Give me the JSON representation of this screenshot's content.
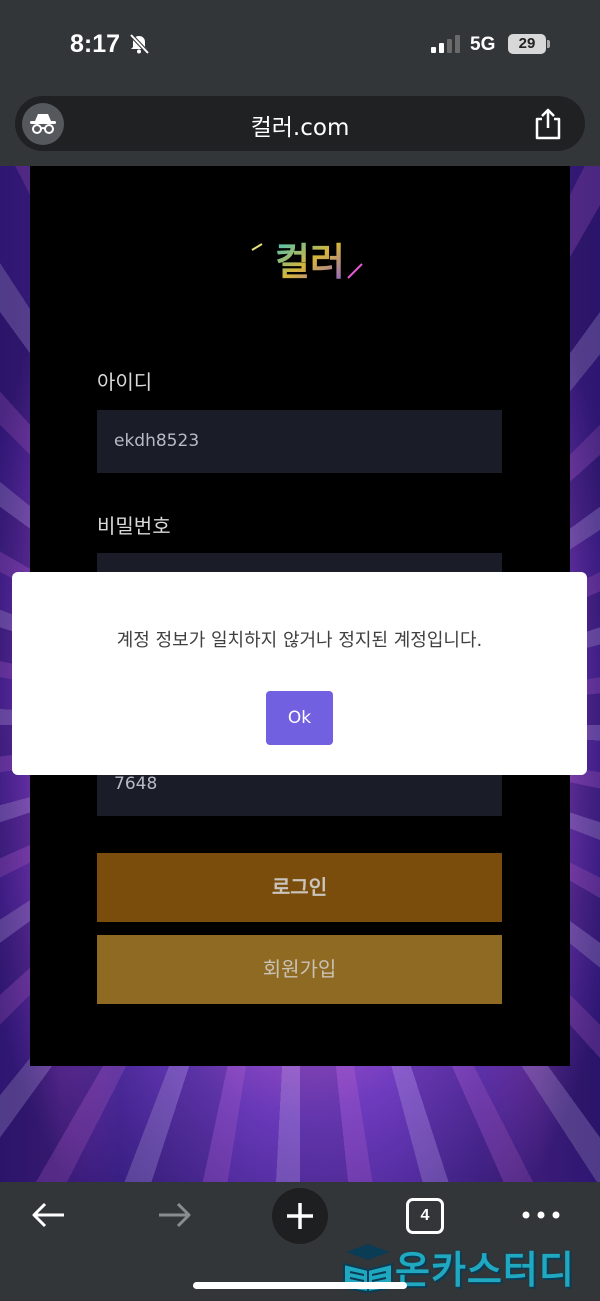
{
  "status_bar": {
    "time": "8:17",
    "network": "5G",
    "battery": "29"
  },
  "address_bar": {
    "url": "컬러.com"
  },
  "page": {
    "logo_text": "컬러",
    "id_label": "아이디",
    "id_value": "ekdh8523",
    "password_label": "비밀번호",
    "extra_field_value": "7648",
    "login_button": "로그인",
    "signup_button": "회원가입"
  },
  "dialog": {
    "message": "계정 정보가 일치하지 않거나 정지된 계정입니다.",
    "ok_button": "Ok"
  },
  "toolbar": {
    "tab_count": "4"
  },
  "watermark": {
    "text": "온카스터디"
  }
}
